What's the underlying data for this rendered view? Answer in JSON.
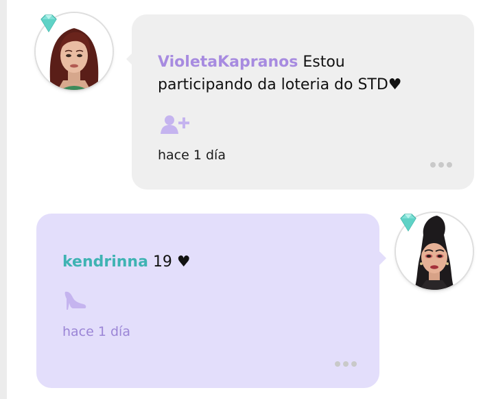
{
  "comments": [
    {
      "username": "VioletaKapranos",
      "text_line1": "Estou",
      "text_line2": "participando da loteria do STD♥",
      "time": "hace 1 día",
      "username_color": "#a78be0",
      "badge_icon": "add-friend-icon",
      "more_icon": "more-dots-icon",
      "avatar_icon": "user-avatar-icon",
      "gem_icon": "diamond-icon"
    },
    {
      "username": "kendrinna",
      "text": "19 ♥",
      "time": "hace 1 día",
      "username_color": "#3fb3b3",
      "badge_icon": "high-heel-icon",
      "more_icon": "more-dots-icon",
      "avatar_icon": "user-avatar-icon",
      "gem_icon": "diamond-icon"
    }
  ],
  "colors": {
    "gray_bubble": "#efefef",
    "purple_bubble": "#e3defb",
    "accent_purple": "#a78be0",
    "accent_teal": "#3fb3b3",
    "muted_purple_text": "#9b85d6"
  }
}
